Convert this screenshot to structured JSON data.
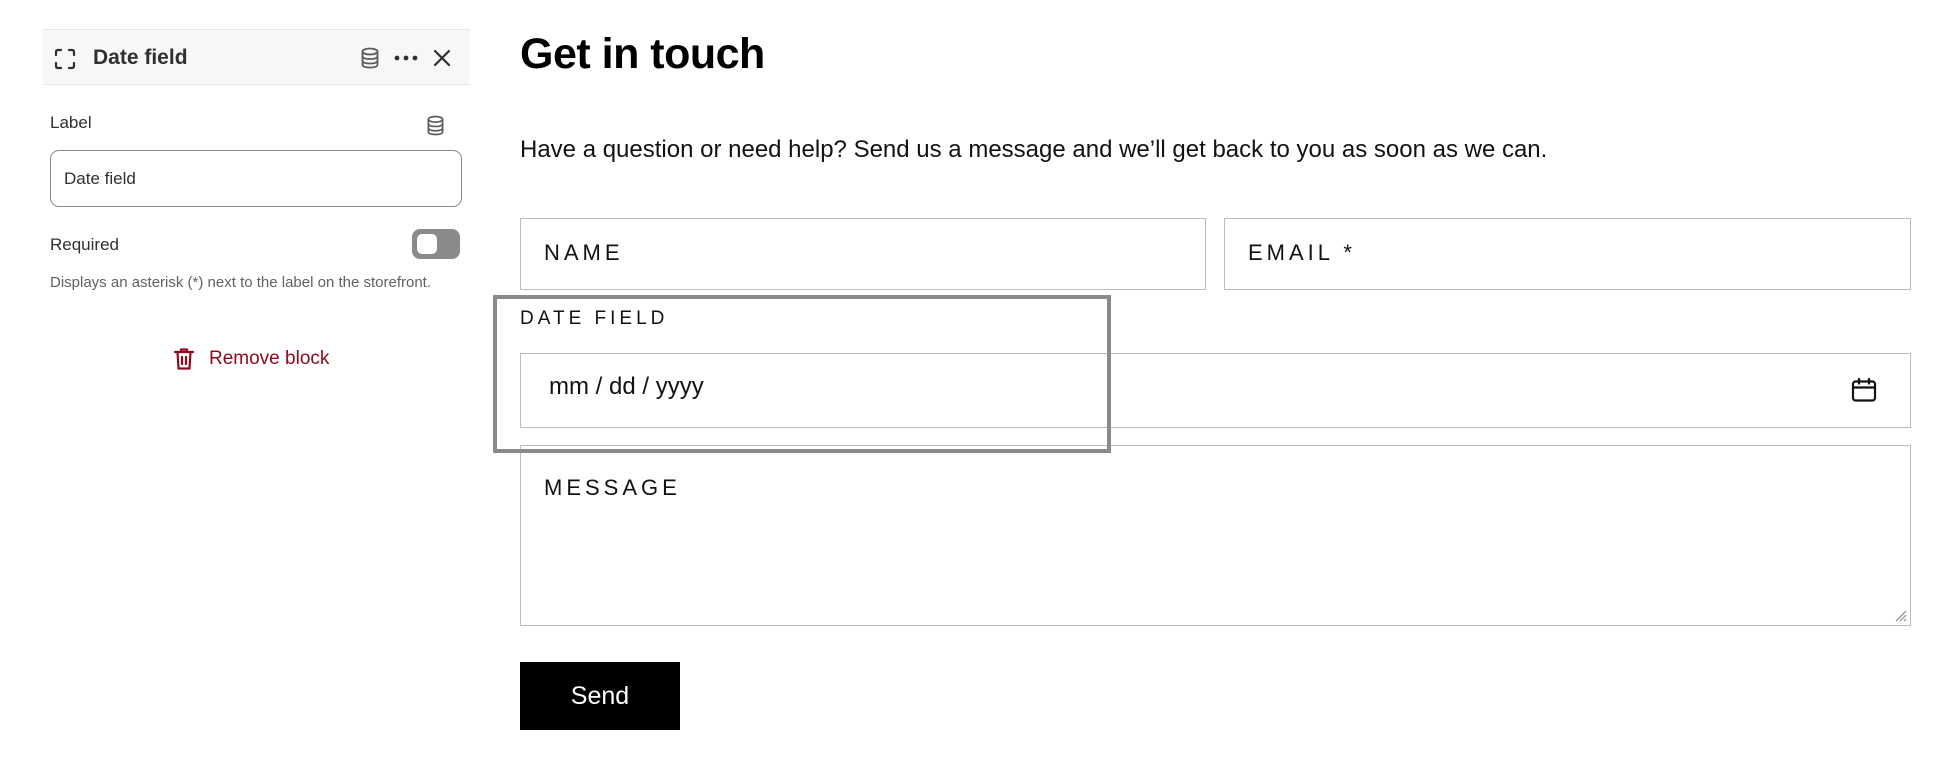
{
  "panel": {
    "title": "Date field",
    "label_field": {
      "label": "Label",
      "value": "Date field"
    },
    "required": {
      "label": "Required",
      "enabled": false,
      "help_text": "Displays an asterisk (*) next to the label on the storefront."
    },
    "remove_label": "Remove block"
  },
  "form": {
    "heading": "Get in touch",
    "description": "Have a question or need help? Send us a message and we’ll get back to you as soon as we can.",
    "name_placeholder": "NAME",
    "email_placeholder": "EMAIL *",
    "date_label": "DATE FIELD",
    "date_placeholder": "mm / dd / yyyy",
    "message_placeholder": "MESSAGE",
    "send_label": "Send"
  },
  "icons": {
    "block": "frame-corners-icon",
    "dynamic_source": "database-icon",
    "more": "ellipsis-icon",
    "close": "close-icon",
    "delete": "trash-icon",
    "calendar": "calendar-icon"
  },
  "colors": {
    "danger": "#8e0b21",
    "toggle_off": "#8a8a8a",
    "button_bg": "#000000",
    "selection_outline": "#8a8a8a"
  }
}
